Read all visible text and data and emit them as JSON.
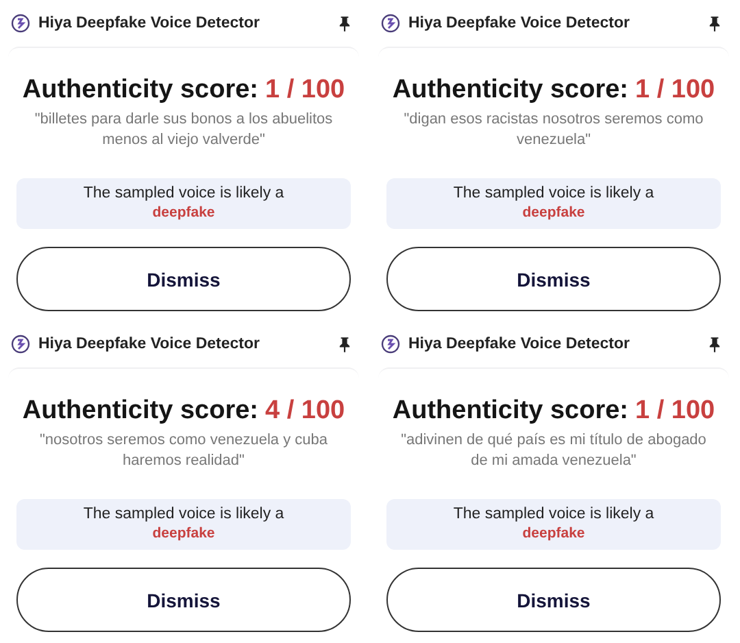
{
  "panels": [
    {
      "title": "Hiya Deepfake Voice Detector",
      "score_label": "Authenticity score:",
      "score": "1 / 100",
      "quote": "\"billetes para darle sus bonos a los abuelitos menos al viejo valverde\"",
      "verdict": "The sampled voice is likely a",
      "verdict_word": "deepfake",
      "button": "Dismiss"
    },
    {
      "title": "Hiya Deepfake Voice Detector",
      "score_label": "Authenticity score:",
      "score": "1 / 100",
      "quote": "\"digan esos racistas nosotros seremos como venezuela\"",
      "verdict": "The sampled voice is likely a",
      "verdict_word": "deepfake",
      "button": "Dismiss"
    },
    {
      "title": "Hiya Deepfake Voice Detector",
      "score_label": "Authenticity score:",
      "score": "4 / 100",
      "quote": "\"nosotros seremos como venezuela y cuba haremos realidad\"",
      "verdict": "The sampled voice is likely a",
      "verdict_word": "deepfake",
      "button": "Dismiss"
    },
    {
      "title": "Hiya Deepfake Voice Detector",
      "score_label": "Authenticity score:",
      "score": "1 / 100",
      "quote": "\"adivinen de qué país es mi título de abogado de mi amada venezuela\"",
      "verdict": "The sampled voice is likely a",
      "verdict_word": "deepfake",
      "button": "Dismiss"
    }
  ]
}
